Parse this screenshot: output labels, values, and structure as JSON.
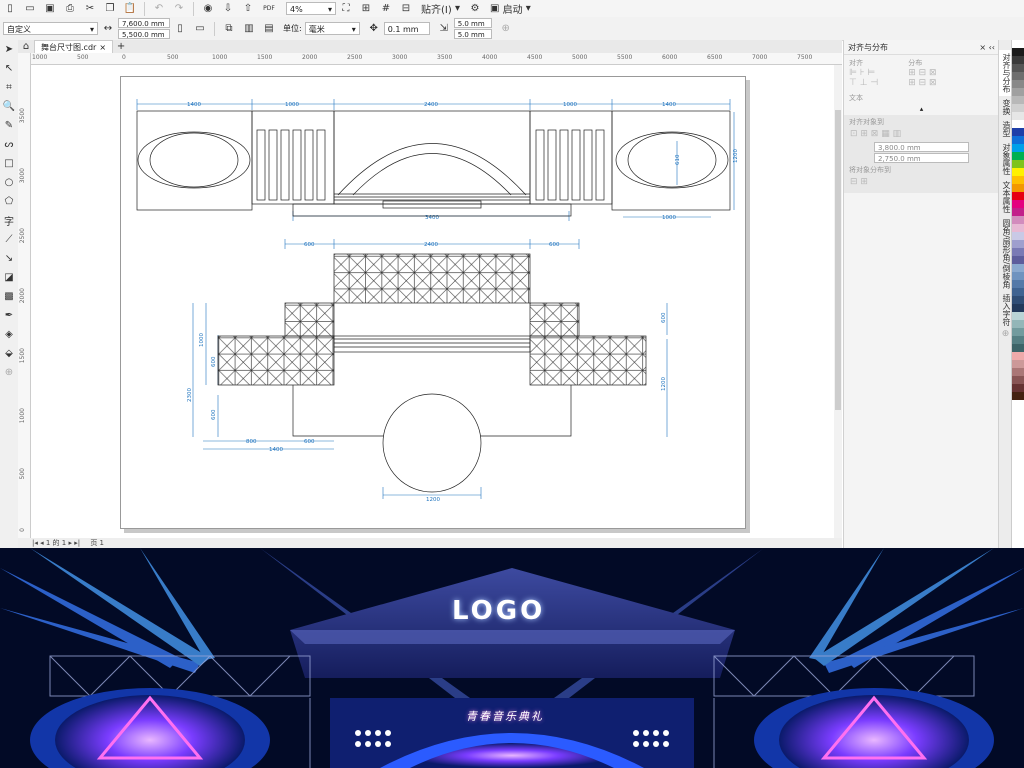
{
  "toolbar": {
    "zoom": "4%",
    "pdf_label": "PDF",
    "snap_label": "贴齐(I)",
    "launch_label": "启动"
  },
  "properties": {
    "preset": "自定义",
    "width": "7,600.0 mm",
    "height": "5,500.0 mm",
    "unit_label": "单位:",
    "unit": "毫米",
    "nudge": "0.1 mm",
    "dup_x": "5.0 mm",
    "dup_y": "5.0 mm"
  },
  "document": {
    "tab_name": "舞台尺寸图.cdr",
    "page_counter": "1 的 1",
    "page_name": "页 1"
  },
  "ruler": {
    "h_ticks": [
      "1000",
      "500",
      "0",
      "500",
      "1000",
      "1500",
      "2000",
      "2500",
      "3000",
      "3500",
      "4000",
      "4500",
      "5000",
      "5500",
      "6000",
      "6500",
      "7000",
      "7500"
    ],
    "v_ticks": [
      "3500",
      "3000",
      "2500",
      "2000",
      "1500",
      "1000",
      "500",
      "0"
    ]
  },
  "drawing": {
    "top": {
      "dims": [
        "1400",
        "1000",
        "2400",
        "1000",
        "1400"
      ],
      "bottom_dims": [
        "3400",
        "1000"
      ],
      "side_dims": [
        "1200",
        "610"
      ]
    },
    "plan": {
      "dims_top": [
        "600",
        "2400",
        "600"
      ],
      "dims_left": [
        "1000",
        "600",
        "2300",
        "600"
      ],
      "dims_bottom": [
        "800",
        "600",
        "1400"
      ],
      "dims_right": [
        "600",
        "1200"
      ],
      "circle_dim": "1200"
    }
  },
  "docker": {
    "title": "对齐与分布",
    "align_label": "对齐",
    "distribute_label": "分布",
    "text_label": "文本",
    "align_objects_to": "对齐对象到",
    "x_value": "3,800.0 mm",
    "y_value": "2,750.0 mm",
    "distribute_to": "将对象分布到"
  },
  "side_tabs": [
    "对齐与分布",
    "变换",
    "造型",
    "对象属性",
    "文本属性",
    "圆角/扇形角/倒棱角",
    "插入字符"
  ],
  "palette": [
    "#ffffff",
    "#1b1b1b",
    "#3a3a3a",
    "#555555",
    "#6e6e6e",
    "#888888",
    "#a0a0a0",
    "#b8b8b8",
    "#d0d0d0",
    "#e6e6e6",
    "#ffffff",
    "#1e3ea8",
    "#0f6fd8",
    "#00a0e9",
    "#00b050",
    "#7fc31c",
    "#fff100",
    "#ffc000",
    "#f39800",
    "#e60012",
    "#e4007f",
    "#c21f8a",
    "#d28cbd",
    "#e7b9d4",
    "#c9c9e6",
    "#9f9fce",
    "#7a7ab5",
    "#5d5d9c",
    "#8aa9cf",
    "#6f93bf",
    "#5479a8",
    "#3f6391",
    "#2f4d75",
    "#22395b",
    "#bad4d6",
    "#93b6b8",
    "#729b9e",
    "#557f83",
    "#3d6468",
    "#eaa",
    "#c99",
    "#a77",
    "#855",
    "#633",
    "#421"
  ],
  "render": {
    "logo": "LOGO",
    "slogan": "青春音乐典礼"
  }
}
